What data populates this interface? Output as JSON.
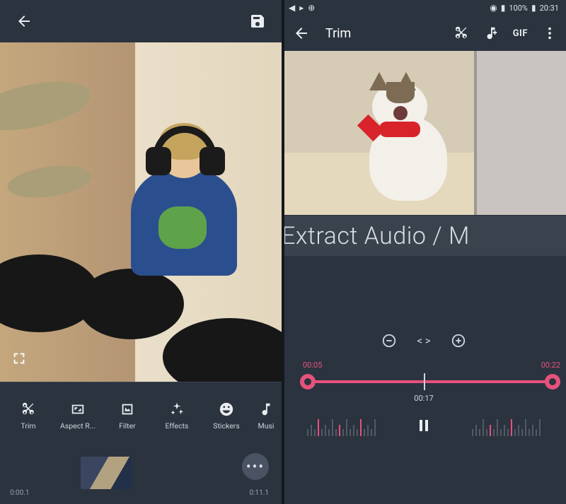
{
  "left": {
    "toolbar": {
      "trim": "Trim",
      "aspect": "Aspect R...",
      "filter": "Filter",
      "effects": "Effects",
      "stickers": "Stickers",
      "music": "Musi"
    },
    "time_start": "0:00.1",
    "time_end": "0:11.1"
  },
  "right": {
    "status": {
      "battery": "100%",
      "clock": "20:31"
    },
    "title": "Trim",
    "gif": "GIF",
    "extract_label": "Extract Audio / M",
    "trim": {
      "start": "00:05",
      "end": "00:22",
      "playhead": "00:17"
    }
  }
}
